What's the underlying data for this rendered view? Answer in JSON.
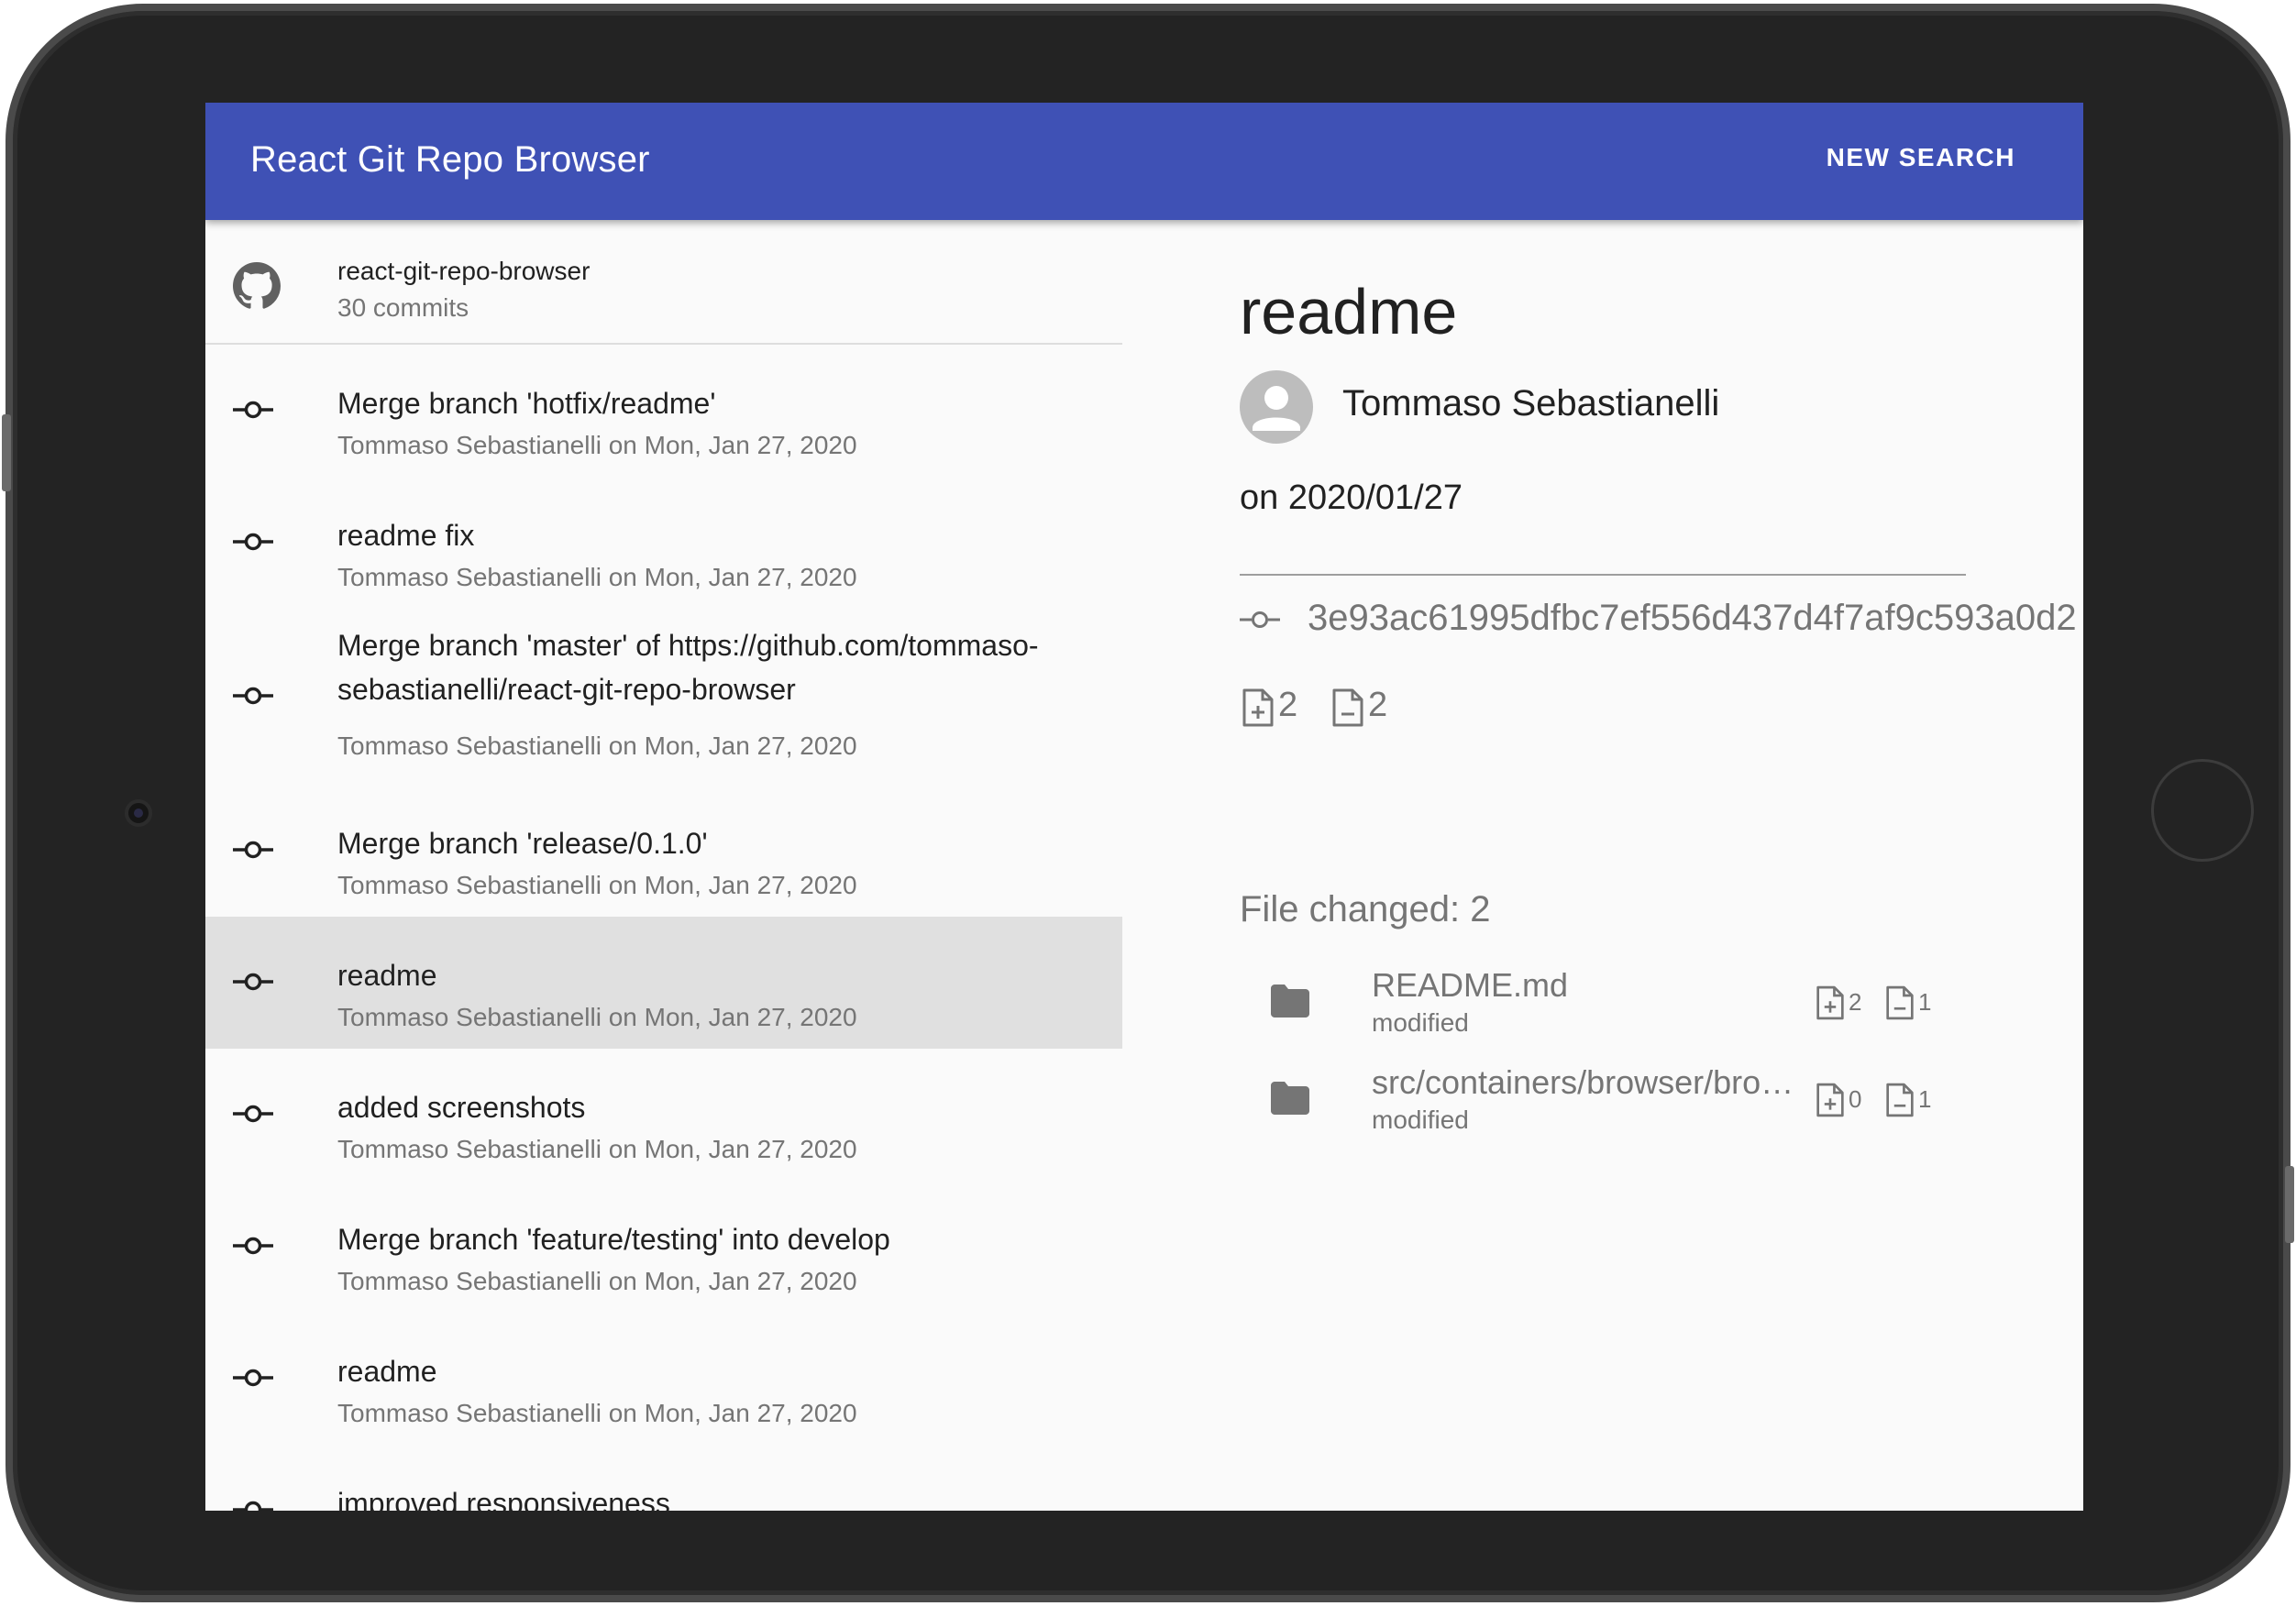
{
  "app": {
    "title": "React Git Repo Browser",
    "new_search_label": "NEW SEARCH",
    "accent_color": "#3f51b5"
  },
  "repo": {
    "name": "react-git-repo-browser",
    "commit_count": "30 commits",
    "icon": "github-icon"
  },
  "commits": [
    {
      "title": "Merge branch 'hotfix/readme'",
      "meta": "Tommaso Sebastianelli on Mon, Jan 27, 2020"
    },
    {
      "title": "readme fix",
      "meta": "Tommaso Sebastianelli on Mon, Jan 27, 2020"
    },
    {
      "title": "Merge branch 'master' of https://github.com/tommaso-sebastianelli/react-git-repo-browser",
      "meta": "Tommaso Sebastianelli on Mon, Jan 27, 2020"
    },
    {
      "title": "Merge branch 'release/0.1.0'",
      "meta": "Tommaso Sebastianelli on Mon, Jan 27, 2020"
    },
    {
      "title": "readme",
      "meta": "Tommaso Sebastianelli on Mon, Jan 27, 2020",
      "selected": true
    },
    {
      "title": "added screenshots",
      "meta": "Tommaso Sebastianelli on Mon, Jan 27, 2020"
    },
    {
      "title": "Merge branch 'feature/testing' into develop",
      "meta": "Tommaso Sebastianelli on Mon, Jan 27, 2020"
    },
    {
      "title": "readme",
      "meta": "Tommaso Sebastianelli on Mon, Jan 27, 2020"
    },
    {
      "title": "improved responsiveness",
      "meta": ""
    }
  ],
  "detail": {
    "title": "readme",
    "author": "Tommaso Sebastianelli",
    "date": "on 2020/01/27",
    "sha": "3e93ac61995dfbc7ef556d437d4f7af9c593a0d2",
    "additions": "2",
    "deletions": "2",
    "files_changed": "File changed: 2",
    "files": [
      {
        "name": "README.md",
        "status": "modified",
        "additions": "2",
        "deletions": "1"
      },
      {
        "name": "src/containers/browser/browser.js",
        "status": "modified",
        "additions": "0",
        "deletions": "1"
      }
    ]
  }
}
